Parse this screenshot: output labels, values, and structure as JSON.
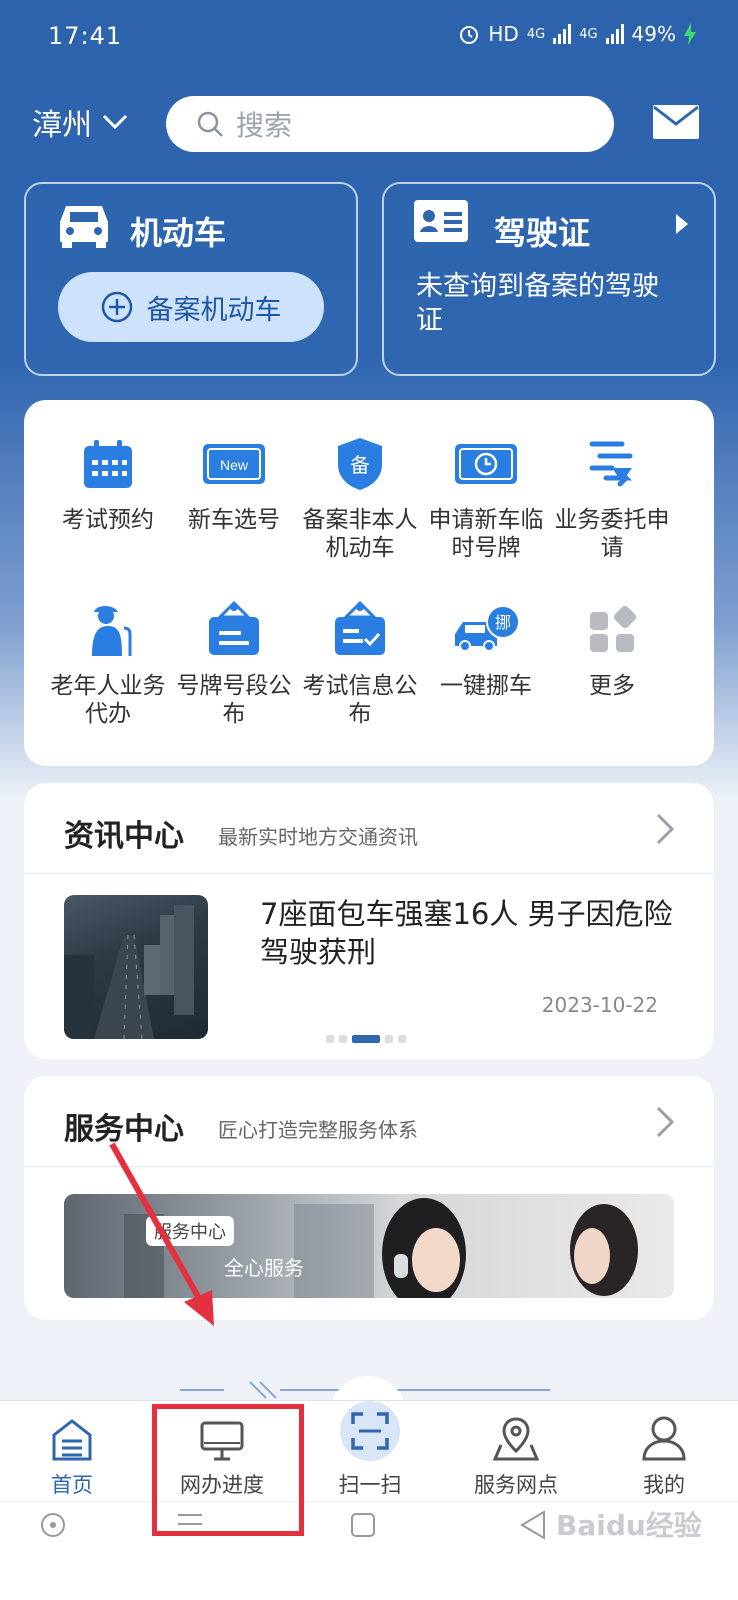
{
  "status_bar": {
    "time": "17:41",
    "indicators": "HD",
    "net1": "4G",
    "net2": "4G",
    "battery": "49%"
  },
  "header": {
    "city": "漳州",
    "search_placeholder": "搜索"
  },
  "vehicle_card": {
    "title": "机动车",
    "add_button": "备案机动车"
  },
  "license_card": {
    "title": "驾驶证",
    "text": "未查询到备案的驾驶证"
  },
  "services": [
    {
      "label": "考试预约",
      "icon": "calendar-icon"
    },
    {
      "label": "新车选号",
      "icon": "new-plate-icon"
    },
    {
      "label": "备案非本人机动车",
      "icon": "shield-bei-icon"
    },
    {
      "label": "申请新车临时号牌",
      "icon": "temp-plate-icon"
    },
    {
      "label": "业务委托申请",
      "icon": "delegate-icon"
    },
    {
      "label": "老年人业务代办",
      "icon": "elder-icon"
    },
    {
      "label": "号牌号段公布",
      "icon": "plate-board-icon"
    },
    {
      "label": "考试信息公布",
      "icon": "exam-board-icon"
    },
    {
      "label": "一键挪车",
      "icon": "move-car-icon"
    },
    {
      "label": "更多",
      "icon": "more-grid-icon"
    }
  ],
  "news": {
    "title": "资讯中心",
    "subtitle": "最新实时地方交通资讯",
    "headline": "7座面包车强塞16人 男子因危险驾驶获刑",
    "date": "2023-10-22"
  },
  "service_center": {
    "title": "服务中心",
    "subtitle": "匠心打造完整服务体系",
    "banner_tag": "服务中心",
    "banner_text": "全心服务"
  },
  "bottom_nav": [
    {
      "label": "首页",
      "icon": "home-icon",
      "active": true
    },
    {
      "label": "网办进度",
      "icon": "monitor-icon",
      "active": false
    },
    {
      "label": "扫一扫",
      "icon": "scan-icon",
      "active": false
    },
    {
      "label": "服务网点",
      "icon": "map-pin-icon",
      "active": false
    },
    {
      "label": "我的",
      "icon": "user-icon",
      "active": false
    }
  ],
  "watermark": "Baidu经验",
  "colors": {
    "primary": "#2f66b0",
    "icon_blue": "#2a7de1",
    "annotation_red": "#e53040"
  }
}
